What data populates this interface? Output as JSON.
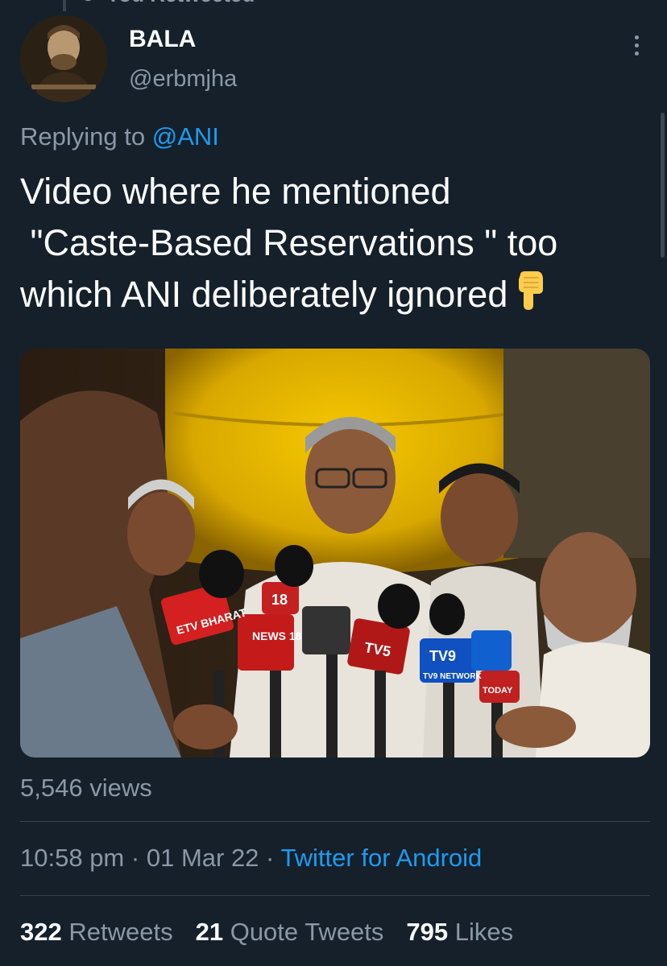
{
  "retweet_context": {
    "text": "You Retweeted"
  },
  "author": {
    "display_name": "BALA",
    "handle": "@erbmjha"
  },
  "reply": {
    "prefix": "Replying to",
    "mention": "@ANI"
  },
  "tweet": {
    "lines": [
      "Video where he mentioned",
      " \"Caste-Based Reservations \" too",
      "which ANI deliberately ignored"
    ],
    "emoji_icon": "backhand-index-pointing-down-icon"
  },
  "media": {
    "type": "video-thumbnail",
    "mic_labels": [
      "ETV BHARAT",
      "NEWS 18",
      "18",
      "TV5",
      "TV9",
      "TV9 NETWORK",
      "TODAY"
    ]
  },
  "views": "5,546 views",
  "meta": {
    "time": "10:58 pm",
    "separator": "·",
    "date": "01 Mar 22",
    "source": "Twitter for Android"
  },
  "stats": {
    "retweets_count": "322",
    "retweets_label": "Retweets",
    "quotes_count": "21",
    "quotes_label": "Quote Tweets",
    "likes_count": "795",
    "likes_label": "Likes"
  },
  "colors": {
    "background": "#15202b",
    "muted": "#8b98a5",
    "accent": "#1d9bf0",
    "divider": "#38444d"
  }
}
